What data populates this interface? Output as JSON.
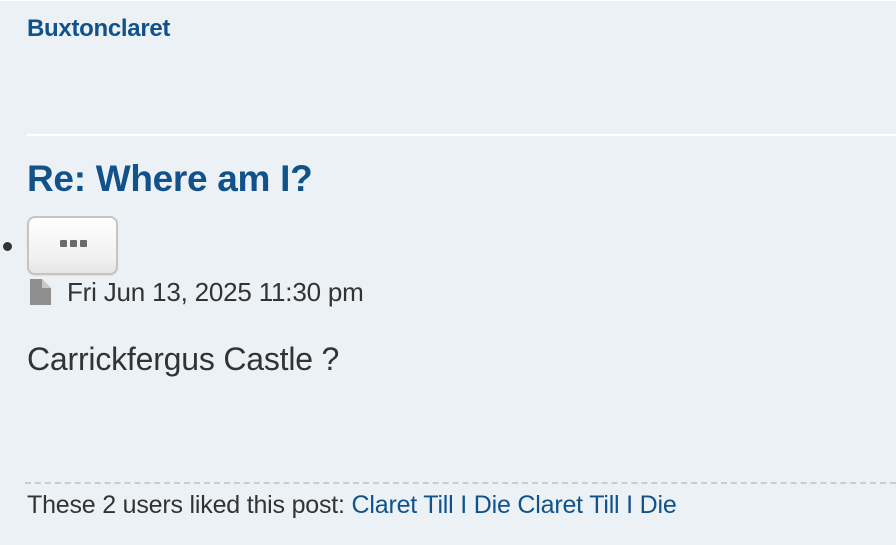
{
  "post": {
    "author": "Buxtonclaret",
    "title": "Re: Where am I?",
    "menu_icon": "ellipsis-icon",
    "date_icon": "file-icon",
    "date": "Fri Jun 13, 2025 11:30 pm",
    "content": "Carrickfergus Castle ?",
    "likes": {
      "prefix": "These 2 users liked this post:",
      "users": [
        "Claret Till I Die",
        "Claret Till I Die"
      ]
    }
  },
  "colors": {
    "background": "#ecf1f5",
    "link": "#105289",
    "text": "#333333"
  }
}
